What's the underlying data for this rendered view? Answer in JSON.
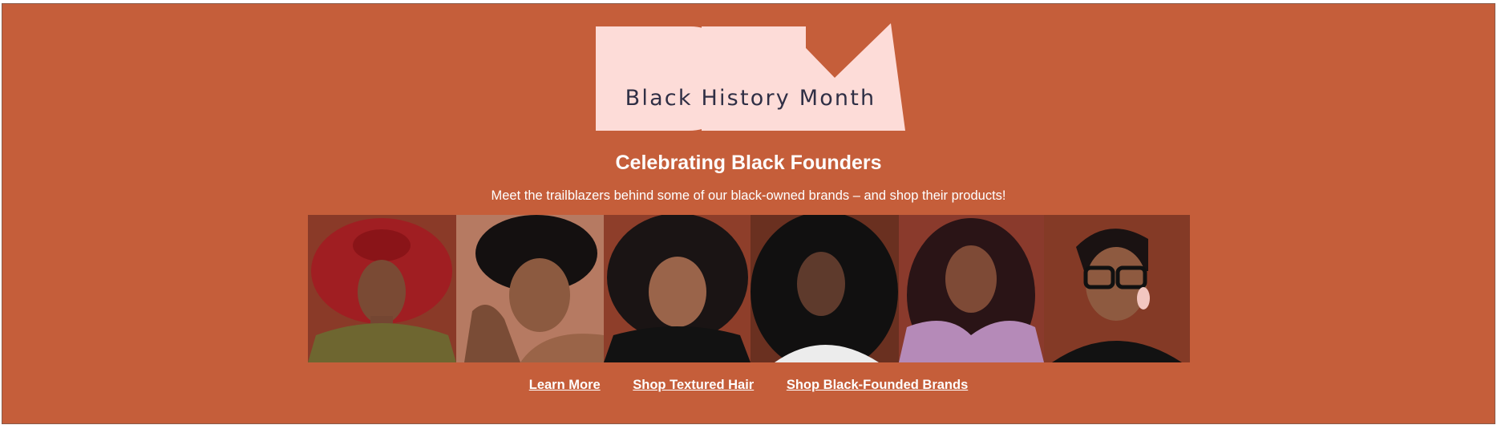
{
  "logo": {
    "caption": "Black History Month",
    "fill_color": "#fddcd8"
  },
  "headline": "Celebrating Black Founders",
  "subline": "Meet the trailblazers behind some of our black-owned brands – and shop their products!",
  "links": {
    "learn_more": "Learn More",
    "shop_textured_hair": "Shop Textured Hair",
    "shop_black_founded": "Shop Black-Founded Brands"
  },
  "colors": {
    "banner_bg": "#c55e3a",
    "text": "#ffffff",
    "logo_text": "#2f2f45"
  }
}
